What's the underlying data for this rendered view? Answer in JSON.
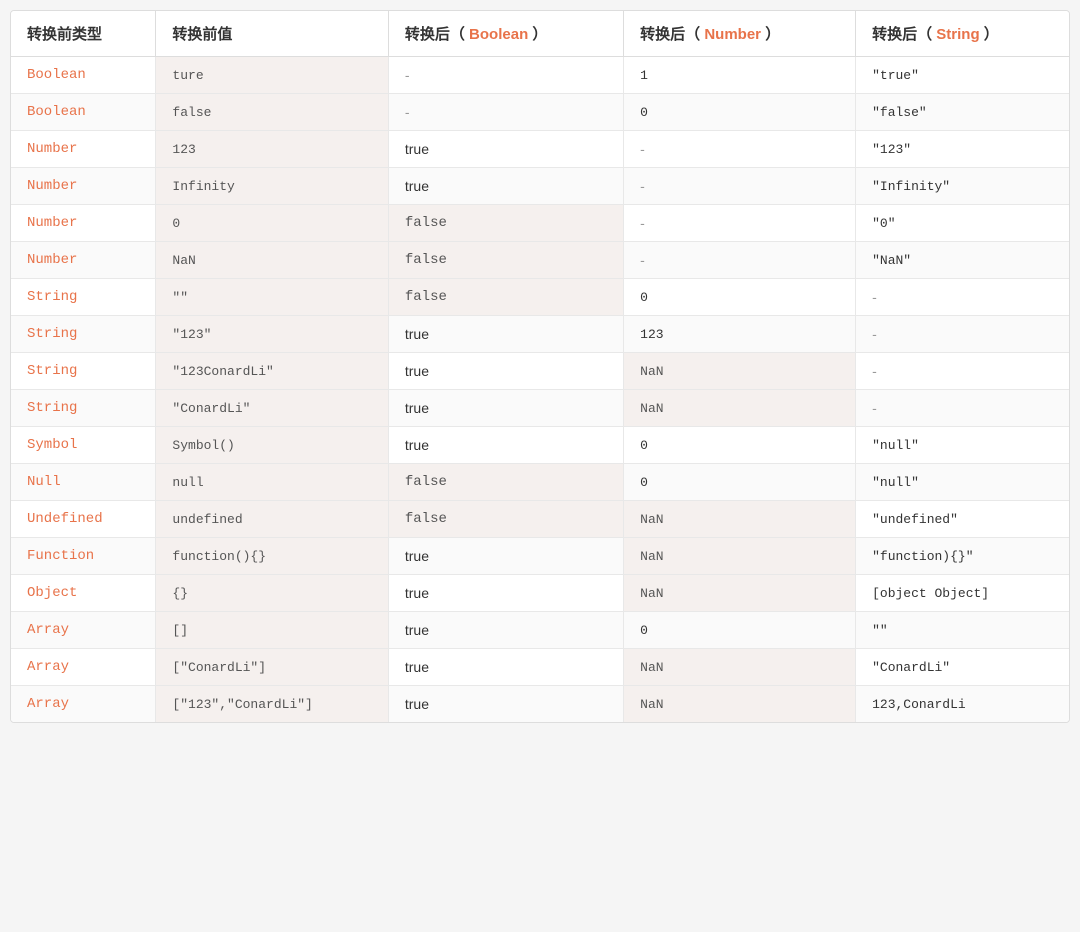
{
  "table": {
    "headers": [
      {
        "label": "转换前类型",
        "highlight": false
      },
      {
        "label": "转换前值",
        "highlight": false
      },
      {
        "label": "转换后( ",
        "highlight_word": "Boolean",
        "suffix": " )",
        "highlight": true
      },
      {
        "label": "转换后( ",
        "highlight_word": "Number",
        "suffix": " )",
        "highlight": true
      },
      {
        "label": "转换后( ",
        "highlight_word": "String",
        "suffix": " )",
        "highlight": true
      }
    ],
    "rows": [
      {
        "type": "Boolean",
        "value": "ture",
        "toBoolean": "-",
        "toNumber": "1",
        "toString": "\"true\""
      },
      {
        "type": "Boolean",
        "value": "false",
        "toBoolean": "-",
        "toNumber": "0",
        "toString": "\"false\""
      },
      {
        "type": "Number",
        "value": "123",
        "toBoolean": "true",
        "toNumber": "-",
        "toString": "\"123\""
      },
      {
        "type": "Number",
        "value": "Infinity",
        "toBoolean": "true",
        "toNumber": "-",
        "toString": "\"Infinity\""
      },
      {
        "type": "Number",
        "value": "0",
        "toBoolean": "false",
        "toNumber": "-",
        "toString": "\"0\""
      },
      {
        "type": "Number",
        "value": "NaN",
        "toBoolean": "false",
        "toNumber": "-",
        "toString": "\"NaN\""
      },
      {
        "type": "String",
        "value": "\"\"",
        "toBoolean": "false",
        "toNumber": "0",
        "toString": "-"
      },
      {
        "type": "String",
        "value": "\"123\"",
        "toBoolean": "true",
        "toNumber": "123",
        "toString": "-"
      },
      {
        "type": "String",
        "value": "\"123ConardLi\"",
        "toBoolean": "true",
        "toNumber": "NaN",
        "toString": "-"
      },
      {
        "type": "String",
        "value": "\"ConardLi\"",
        "toBoolean": "true",
        "toNumber": "NaN",
        "toString": "-"
      },
      {
        "type": "Symbol",
        "value": "Symbol()",
        "toBoolean": "true",
        "toNumber": "0",
        "toString": "\"null\""
      },
      {
        "type": "Null",
        "value": "null",
        "toBoolean": "false",
        "toNumber": "0",
        "toString": "\"null\""
      },
      {
        "type": "Undefined",
        "value": "undefined",
        "toBoolean": "false",
        "toNumber": "NaN",
        "toString": "\"undefined\""
      },
      {
        "type": "Function",
        "value": "function(){}",
        "toBoolean": "true",
        "toNumber": "NaN",
        "toString": "\"function){}\""
      },
      {
        "type": "Object",
        "value": "{}",
        "toBoolean": "true",
        "toNumber": "NaN",
        "toString": "[object Object]"
      },
      {
        "type": "Array",
        "value": "[]",
        "toBoolean": "true",
        "toNumber": "0",
        "toString": "\"\""
      },
      {
        "type": "Array",
        "value": "[\"ConardLi\"]",
        "toBoolean": "true",
        "toNumber": "NaN",
        "toString": "\"ConardLi\""
      },
      {
        "type": "Array",
        "value": "[\"123\",\"ConardLi\"]",
        "toBoolean": "true",
        "toNumber": "NaN",
        "toString": "123,ConardLi"
      }
    ]
  }
}
